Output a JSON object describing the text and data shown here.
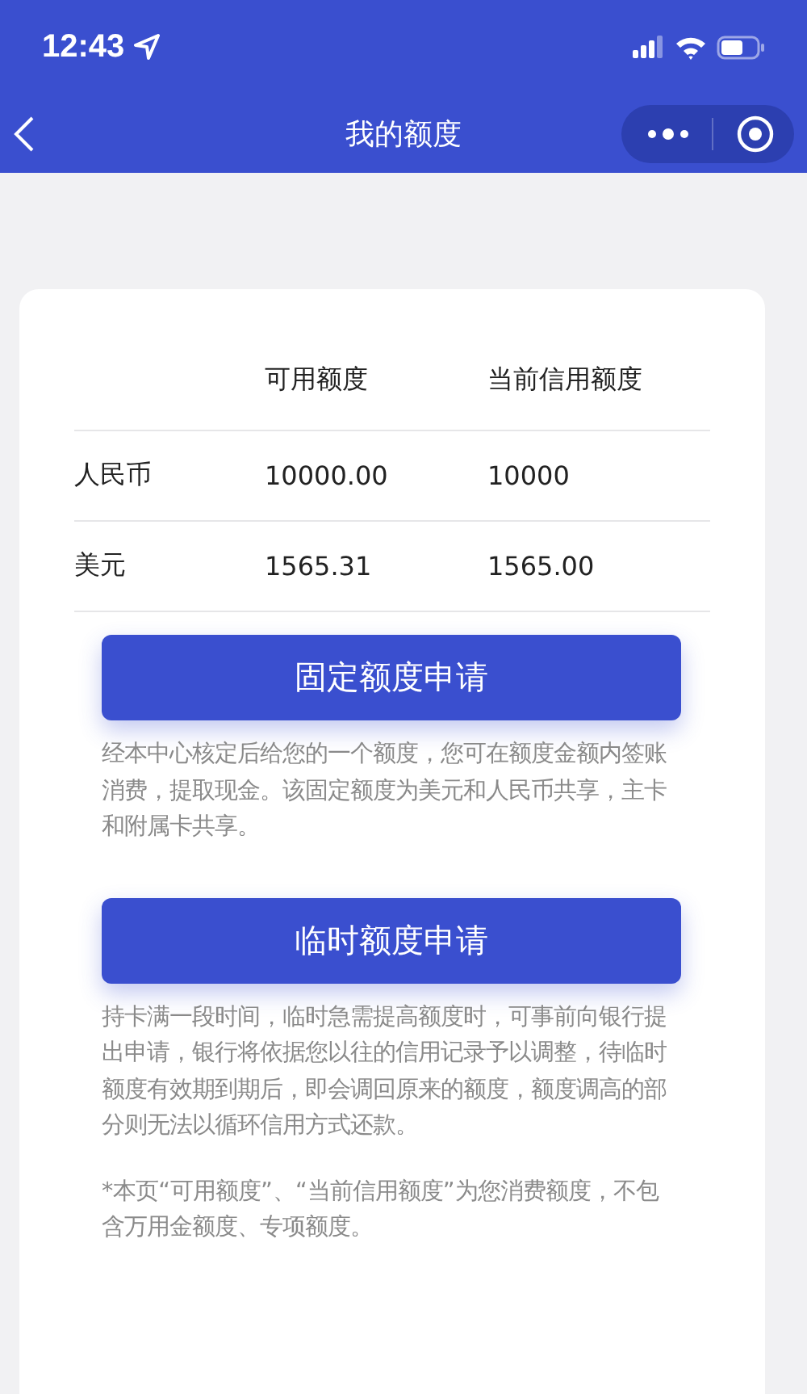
{
  "status_bar": {
    "time": "12:43"
  },
  "nav": {
    "title": "我的额度"
  },
  "table": {
    "columns": [
      "可用额度",
      "当前信用额度"
    ],
    "rows": [
      {
        "currency": "人民币",
        "available": "10000.00",
        "limit": "10000"
      },
      {
        "currency": "美元",
        "available": "1565.31",
        "limit": "1565.00"
      }
    ]
  },
  "sections": [
    {
      "button": "固定额度申请",
      "text": "经本中心核定后给您的一个额度，您可在额度金额内签账消费，提取现金。该固定额度为美元和人民币共享，主卡和附属卡共享。"
    },
    {
      "button": "临时额度申请",
      "text": "持卡满一段时间，临时急需提高额度时，可事前向银行提出申请，银行将依据您以往的信用记录予以调整，待临时额度有效期到期后，即会调回原来的额度，额度调高的部分则无法以循环信用方式还款。"
    }
  ],
  "footnote": "*本页“可用额度”、“当前信用额度”为您消费额度，不包含万用金额度、专项额度。"
}
